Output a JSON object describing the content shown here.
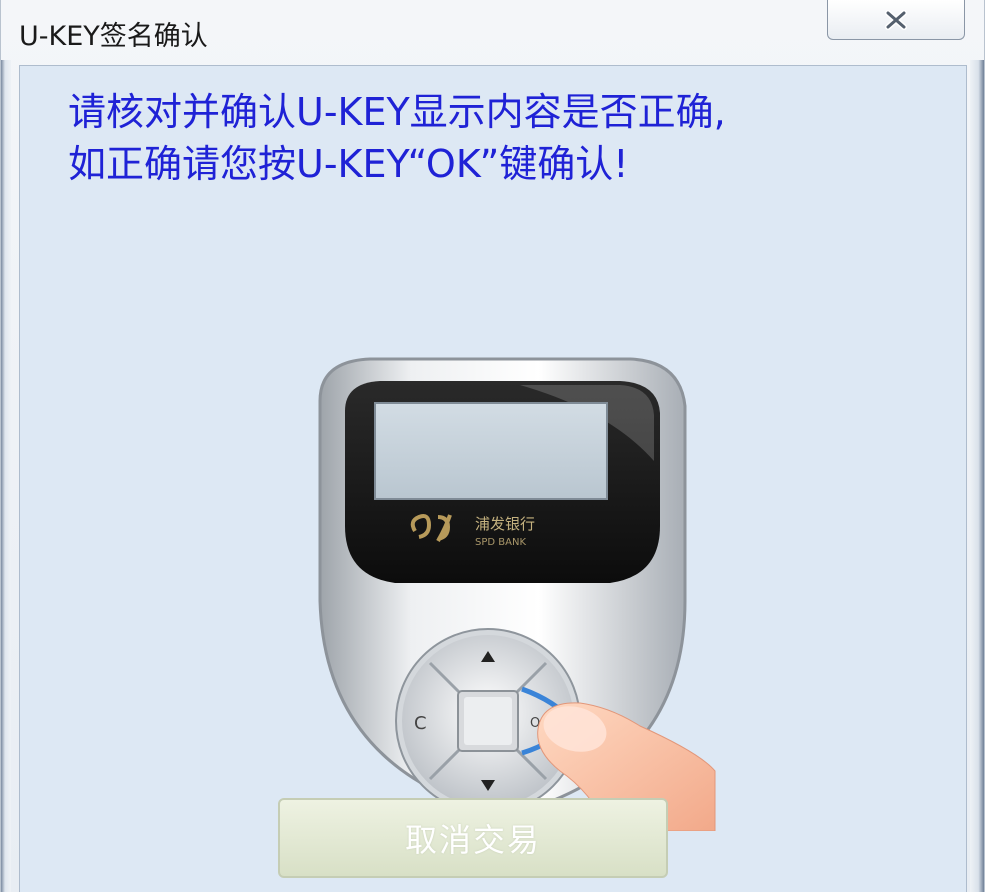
{
  "window": {
    "title": "U-KEY签名确认",
    "close_icon": "close-icon"
  },
  "message": {
    "line1": "请核对并确认U-KEY显示内容是否正确,",
    "line2": "如正确请您按U-KEY“OK”键确认!"
  },
  "device": {
    "brand_cn": "浦发银行",
    "brand_en": "SPD BANK",
    "button_c": "C",
    "button_ok": "OK",
    "icons": [
      "up-arrow-icon",
      "down-arrow-icon",
      "finger-icon"
    ]
  },
  "actions": {
    "cancel_label": "取消交易"
  },
  "colors": {
    "message_text": "#1f22d6",
    "content_bg": "#dde8f4",
    "cancel_bg": "#e2e8d2"
  }
}
